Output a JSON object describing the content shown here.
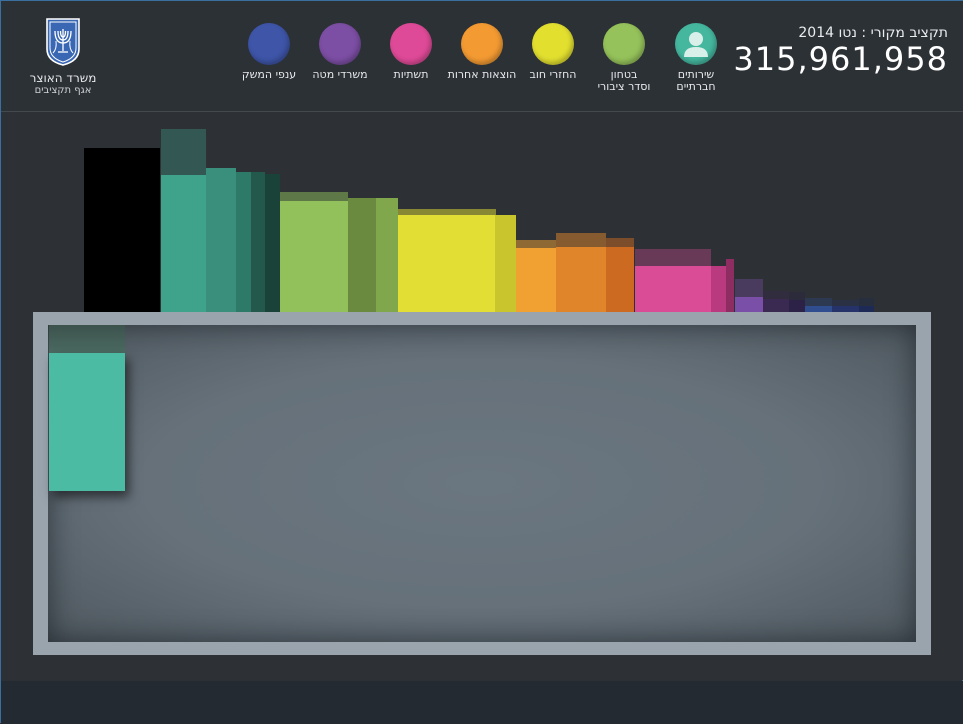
{
  "logo": {
    "title": "משרד האוצר",
    "subtitle": "אגף תקציבים"
  },
  "budget": {
    "label": "תקציב מקורי : נטו 2014",
    "value": "315,961,958"
  },
  "categories": [
    {
      "label": "שירותים\nחברתיים",
      "color": "#45b79f",
      "icon": "person-icon"
    },
    {
      "label": "בטחון\nוסדר ציבורי",
      "color": "#95c25a",
      "icon": ""
    },
    {
      "label": "החזרי חוב",
      "color": "#e2df2f",
      "icon": ""
    },
    {
      "label": "הוצאות אחרות",
      "color": "#f39a32",
      "icon": ""
    },
    {
      "label": "תשתיות",
      "color": "#df4a98",
      "icon": ""
    },
    {
      "label": "משרדי מטה",
      "color": "#7c4ea4",
      "icon": ""
    },
    {
      "label": "ענפי המשק",
      "color": "#3e55a8",
      "icon": ""
    }
  ],
  "chart_data": {
    "type": "bar",
    "bars": [
      {
        "color": "#000000"
      },
      {
        "color": "#3fa38b"
      },
      {
        "color": "#3a8f7c"
      },
      {
        "color": "#2e7a69"
      },
      {
        "color": "#23594d"
      },
      {
        "color": "#1b4239"
      },
      {
        "color": "#92c05b"
      },
      {
        "color": "#6a8b3f"
      },
      {
        "color": "#80a74c"
      },
      {
        "color": "#e2de34"
      },
      {
        "color": "#c9c52c"
      },
      {
        "color": "#f1a132"
      },
      {
        "color": "#e0852a"
      },
      {
        "color": "#cc6a22"
      },
      {
        "color": "#db4c97"
      },
      {
        "color": "#b93a7f"
      },
      {
        "color": "#8e2d62"
      },
      {
        "color": "#7a4fa8"
      },
      {
        "color": "#3a2950"
      },
      {
        "color": "#2c2247"
      },
      {
        "color": "#2f4d8f"
      },
      {
        "color": "#26336a"
      },
      {
        "color": "#1c2a55"
      }
    ],
    "selected": {
      "color": "#4bbba3"
    }
  }
}
